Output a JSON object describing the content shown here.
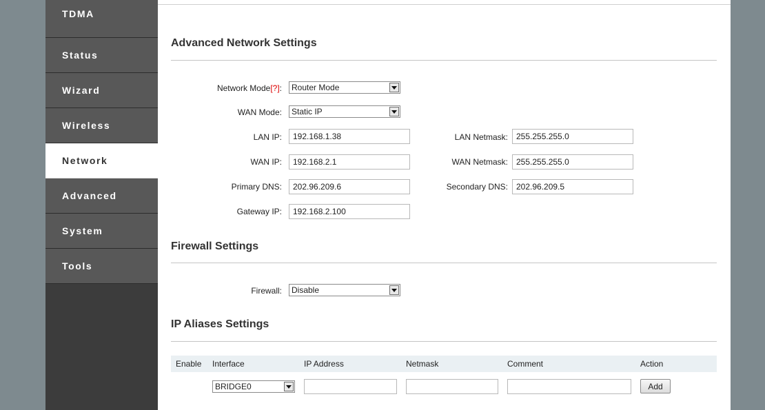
{
  "nav": {
    "items": [
      {
        "label": "TDMA"
      },
      {
        "label": "Status"
      },
      {
        "label": "Wizard"
      },
      {
        "label": "Wireless"
      },
      {
        "label": "Network"
      },
      {
        "label": "Advanced"
      },
      {
        "label": "System"
      },
      {
        "label": "Tools"
      }
    ],
    "active": "Network"
  },
  "advanced": {
    "title": "Advanced Network Settings",
    "network_mode_label": "Network Mode",
    "network_mode_help": "[?]",
    "network_mode_colon": ":",
    "network_mode_value": "Router Mode",
    "wan_mode_label": "WAN Mode:",
    "wan_mode_value": "Static IP",
    "lan_ip_label": "LAN IP:",
    "lan_ip_value": "192.168.1.38",
    "lan_netmask_label": "LAN Netmask:",
    "lan_netmask_value": "255.255.255.0",
    "wan_ip_label": "WAN IP:",
    "wan_ip_value": "192.168.2.1",
    "wan_netmask_label": "WAN Netmask:",
    "wan_netmask_value": "255.255.255.0",
    "primary_dns_label": "Primary DNS:",
    "primary_dns_value": "202.96.209.6",
    "secondary_dns_label": "Secondary DNS:",
    "secondary_dns_value": "202.96.209.5",
    "gateway_label": "Gateway IP:",
    "gateway_value": "192.168.2.100"
  },
  "firewall": {
    "title": "Firewall Settings",
    "label": "Firewall:",
    "value": "Disable"
  },
  "aliases": {
    "title": "IP Aliases Settings",
    "columns": [
      "Enable",
      "Interface",
      "IP Address",
      "Netmask",
      "Comment",
      "Action"
    ],
    "interface_value": "BRIDGE0",
    "ip_value": "",
    "netmask_value": "",
    "comment_value": "",
    "add_label": "Add"
  },
  "icons": {
    "dropdown": "chevron-down-icon"
  },
  "colors": {
    "sidebar": "#585858",
    "sidebar_active": "#ffffff",
    "outer_band": "#7e8a8f",
    "help_link": "#dd0000",
    "table_header": "#eaf0f3"
  }
}
